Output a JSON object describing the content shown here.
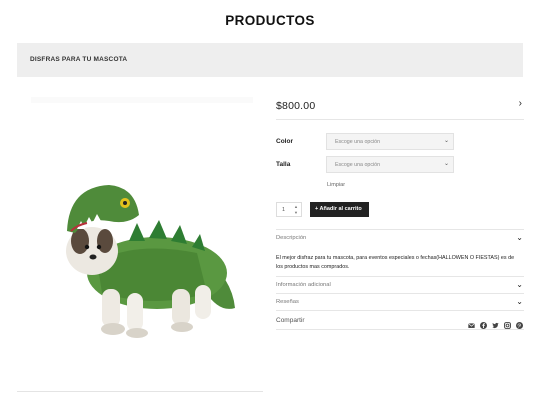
{
  "page": {
    "title": "PRODUCTOS"
  },
  "breadcrumb": {
    "label": "DISFRAS PARA TU MASCOTA"
  },
  "product": {
    "price": "$800.00",
    "options": [
      {
        "label": "Color",
        "placeholder": "Escoge una opción"
      },
      {
        "label": "Talla",
        "placeholder": "Escoge una opción"
      }
    ],
    "clear_label": "Limpiar",
    "quantity": "1",
    "add_to_cart_label": "+ Añadir al carrito",
    "tabs": {
      "description_label": "Descripción",
      "description_text": "El mejor disfraz para tu mascota, para eventos especiales o fechas(HALLOWEN O FIESTAS) es de los productos mas comprados.",
      "additional_info_label": "Información adicional",
      "reviews_label": "Reseñas"
    },
    "share": {
      "label": "Compartir",
      "icons": [
        "email-icon",
        "facebook-icon",
        "twitter-icon",
        "instagram-icon",
        "pinterest-icon"
      ]
    }
  },
  "colors": {
    "costume_green": "#4f8b3a",
    "spikes_green": "#2e7d32",
    "button_dark": "#222222",
    "breadcrumb_bg": "#eeeeee"
  }
}
